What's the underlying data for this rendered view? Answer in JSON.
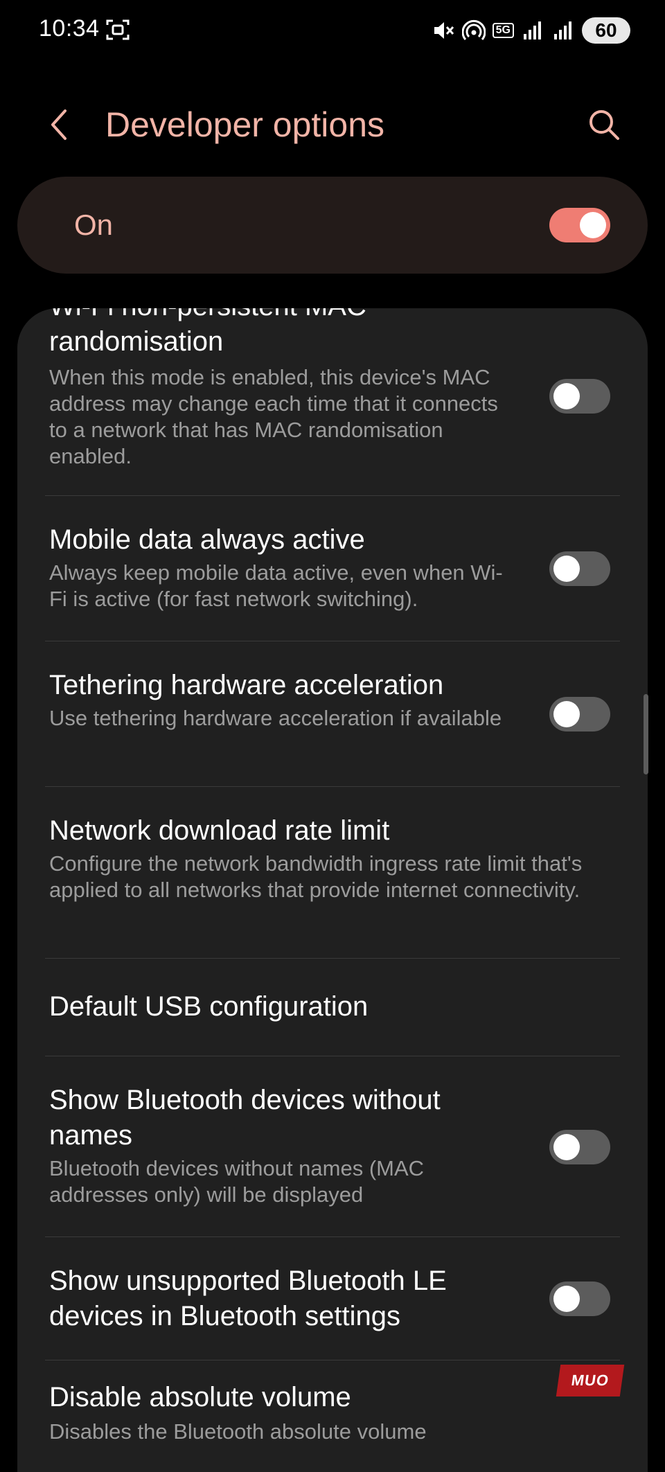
{
  "status_bar": {
    "time": "10:34",
    "network_type": "5G",
    "battery": "60",
    "icons": [
      "screenshot-icon",
      "mute-icon",
      "hotspot-icon",
      "signal-icon",
      "signal-icon",
      "battery-icon"
    ]
  },
  "header": {
    "title": "Developer options",
    "back_icon": "chevron-left-icon",
    "search_icon": "search-icon"
  },
  "master_switch": {
    "label": "On",
    "enabled": true
  },
  "settings": [
    {
      "title": "Wi-Fi non-persistent MAC randomisation",
      "description": "When this mode is enabled, this device's MAC address may change each time that it connects to a network that has MAC randomisation enabled.",
      "has_toggle": true,
      "enabled": false
    },
    {
      "title": "Mobile data always active",
      "description": "Always keep mobile data active, even when Wi-Fi is active (for fast network switching).",
      "has_toggle": true,
      "enabled": false
    },
    {
      "title": "Tethering hardware acceleration",
      "description": "Use tethering hardware acceleration if available",
      "has_toggle": true,
      "enabled": false
    },
    {
      "title": "Network download rate limit",
      "description": "Configure the network bandwidth ingress rate limit that's applied to all networks that provide internet connectivity.",
      "has_toggle": false
    },
    {
      "title": "Default USB configuration",
      "description": "",
      "has_toggle": false
    },
    {
      "title": "Show Bluetooth devices without names",
      "description": "Bluetooth devices without names (MAC addresses only) will be displayed",
      "has_toggle": true,
      "enabled": false
    },
    {
      "title": "Show unsupported Bluetooth LE devices in Bluetooth settings",
      "description": "",
      "has_toggle": true,
      "enabled": false
    },
    {
      "title": "Disable absolute volume",
      "description": "Disables the Bluetooth absolute volume",
      "has_toggle": false
    }
  ],
  "watermark": "MUO",
  "colors": {
    "accent": "#f2b4a7",
    "toggle_on": "#ef7d73",
    "toggle_off": "#5c5c5c",
    "card": "#202020",
    "master_card": "#231b19",
    "secondary_text": "#9c9c9c"
  }
}
